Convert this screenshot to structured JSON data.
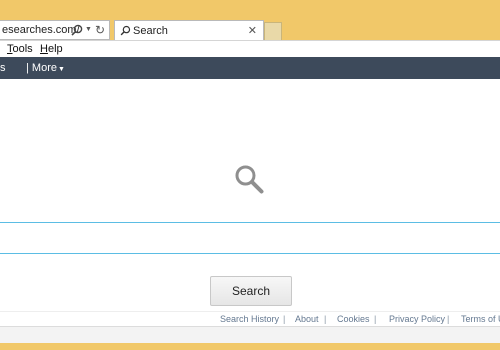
{
  "browser": {
    "address_url": "esearches.com/",
    "tab_title": "Search",
    "menu": [
      {
        "accel": "T",
        "rest": "ools"
      },
      {
        "accel": "H",
        "rest": "elp"
      }
    ]
  },
  "nav": {
    "items": [
      "ws"
    ],
    "more_label": "| More"
  },
  "search": {
    "input_value": "",
    "button_label": "Search"
  },
  "footer": {
    "links": [
      "Search History",
      "About",
      "Cookies",
      "Privacy Policy",
      "Terms of U"
    ],
    "separator": "|"
  },
  "colors": {
    "chrome_frame": "#f1c869",
    "nav_bar": "#3d4a5b",
    "search_border": "#5bbde4",
    "footer_link": "#657991"
  },
  "icons": {
    "address_search": "search-icon",
    "address_dropdown": "chevron-down-icon",
    "address_refresh": "refresh-icon",
    "tab_search": "search-icon",
    "tab_close": "close-icon",
    "hero": "search-icon"
  }
}
